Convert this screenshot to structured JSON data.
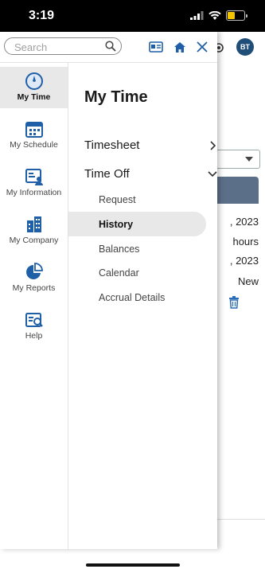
{
  "status": {
    "time": "3:19",
    "battery_level": 0.45,
    "battery_color": "#f5c400"
  },
  "search": {
    "placeholder": "Search"
  },
  "toolbar": {
    "home_icon": "home-icon",
    "close_icon": "close-icon",
    "card_icon": "id-card-icon"
  },
  "background": {
    "avatar_initials": "BT",
    "rows": [
      ", 2023",
      "hours",
      ", 2023",
      "New"
    ]
  },
  "rail": {
    "items": [
      {
        "label": "My Time",
        "icon": "clock-icon",
        "active": true
      },
      {
        "label": "My Schedule",
        "icon": "calendar-icon"
      },
      {
        "label": "My Information",
        "icon": "person-card-icon"
      },
      {
        "label": "My Company",
        "icon": "building-icon"
      },
      {
        "label": "My Reports",
        "icon": "pie-chart-icon"
      },
      {
        "label": "Help",
        "icon": "help-book-icon"
      }
    ]
  },
  "panel": {
    "title": "My Time",
    "menu": [
      {
        "label": "Timesheet",
        "expanded": false
      },
      {
        "label": "Time Off",
        "expanded": true
      }
    ],
    "submenu": [
      "Request",
      "History",
      "Balances",
      "Calendar",
      "Accrual Details"
    ],
    "active_submenu": "History"
  },
  "colors": {
    "accent": "#1f5fa8",
    "header_bg": "#5b7088",
    "selected_bg": "#e8e8e8"
  }
}
